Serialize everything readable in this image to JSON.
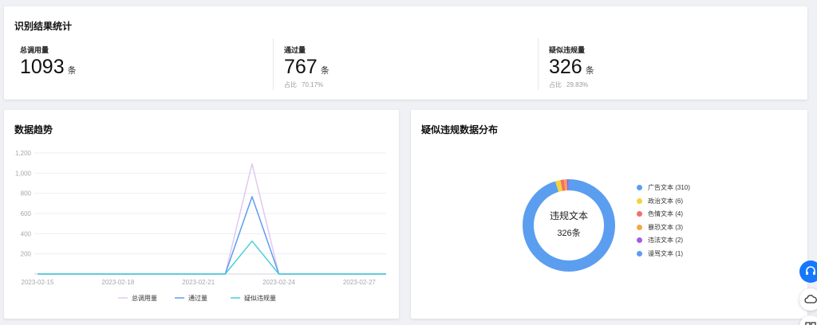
{
  "stats": {
    "title": "识别结果统计",
    "total": {
      "label": "总调用量",
      "value": "1093",
      "unit": "条"
    },
    "passed": {
      "label": "通过量",
      "value": "767",
      "unit": "条",
      "ratio_label": "占比",
      "ratio_value": "70.17%"
    },
    "suspected": {
      "label": "疑似违规量",
      "value": "326",
      "unit": "条",
      "ratio_label": "占比",
      "ratio_value": "29.83%"
    }
  },
  "trend": {
    "title": "数据趋势",
    "colors": {
      "total": "#e2c8f2",
      "passed": "#5b9ef0",
      "suspected": "#4bcfd8"
    }
  },
  "pie": {
    "title": "疑似违规数据分布",
    "center_title": "违规文本",
    "center_value": "326条"
  },
  "chart_data": [
    {
      "type": "line",
      "x": [
        "2023-02-15",
        "2023-02-16",
        "2023-02-17",
        "2023-02-18",
        "2023-02-19",
        "2023-02-20",
        "2023-02-21",
        "2023-02-22",
        "2023-02-23",
        "2023-02-24",
        "2023-02-25",
        "2023-02-26",
        "2023-02-27",
        "2023-02-28"
      ],
      "x_tick_labels": [
        "2023-02-15",
        "2023-02-18",
        "2023-02-21",
        "2023-02-24",
        "2023-02-27"
      ],
      "y_tick_labels": [
        "200",
        "400",
        "600",
        "800",
        "1,000",
        "1,200"
      ],
      "ylim": [
        0,
        1200
      ],
      "grid": true,
      "legend_position": "bottom",
      "series": [
        {
          "name": "总调用量",
          "values": [
            0,
            0,
            0,
            0,
            0,
            0,
            0,
            0,
            1093,
            0,
            0,
            0,
            0,
            0
          ]
        },
        {
          "name": "通过量",
          "values": [
            0,
            0,
            0,
            0,
            0,
            0,
            0,
            0,
            767,
            0,
            0,
            0,
            0,
            0
          ]
        },
        {
          "name": "疑似违规量",
          "values": [
            0,
            0,
            0,
            0,
            0,
            0,
            0,
            0,
            326,
            0,
            0,
            0,
            0,
            0
          ]
        }
      ]
    },
    {
      "type": "pie",
      "labels": [
        "广告文本 (310)",
        "政治文本 (6)",
        "色情文本 (4)",
        "暴恐文本 (3)",
        "违法文本 (2)",
        "谩骂文本 (1)"
      ],
      "values": [
        310,
        6,
        4,
        3,
        2,
        1
      ],
      "colors": [
        "#5b9ef0",
        "#f3d33c",
        "#f2706a",
        "#f7a54a",
        "#a45de0",
        "#5b9ef0"
      ],
      "legend_position": "right"
    }
  ]
}
